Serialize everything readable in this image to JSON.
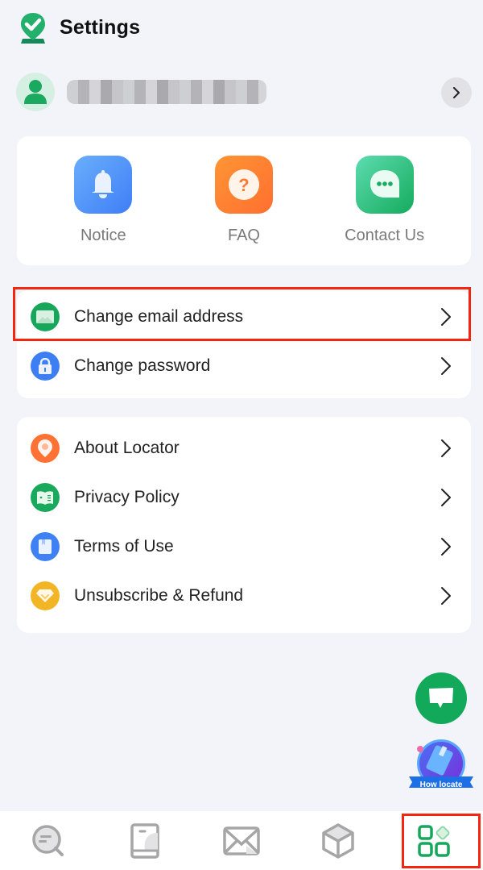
{
  "header": {
    "title": "Settings",
    "logo_icon": "location-check-logo"
  },
  "profile": {
    "avatar_icon": "user-icon",
    "name": "",
    "arrow_icon": "chevron-right-icon"
  },
  "quick_actions": [
    {
      "label": "Notice",
      "icon": "bell-icon",
      "color": "#4a8bf7"
    },
    {
      "label": "FAQ",
      "icon": "question-icon",
      "color": "#ff7a2f"
    },
    {
      "label": "Contact Us",
      "icon": "chat-bubble-icon",
      "color": "#1ab86b"
    }
  ],
  "account_section": [
    {
      "label": "Change email address",
      "icon": "mail-icon",
      "color": "#17a75b",
      "highlighted": true
    },
    {
      "label": "Change password",
      "icon": "lock-icon",
      "color": "#3d7ff2",
      "highlighted": false
    }
  ],
  "about_section": [
    {
      "label": "About Locator",
      "icon": "location-pin-icon",
      "color": "#ff7134"
    },
    {
      "label": "Privacy Policy",
      "icon": "book-icon",
      "color": "#18a95c"
    },
    {
      "label": "Terms of Use",
      "icon": "bookmark-doc-icon",
      "color": "#3f81f4"
    },
    {
      "label": "Unsubscribe & Refund",
      "icon": "diamond-icon",
      "color": "#f2b525"
    }
  ],
  "floating": {
    "chat_icon": "message-icon",
    "how_locate_label": "How locate"
  },
  "tabbar": {
    "tabs": [
      {
        "name": "search-tab",
        "icon": "search-list-icon",
        "active": false
      },
      {
        "name": "guide-tab",
        "icon": "book-tab-icon",
        "active": false
      },
      {
        "name": "messages-tab",
        "icon": "envelope-icon",
        "active": false
      },
      {
        "name": "tools-tab",
        "icon": "cube-icon",
        "active": false
      },
      {
        "name": "settings-tab",
        "icon": "apps-grid-icon",
        "active": true
      }
    ],
    "active_color": "#17a75b",
    "inactive_color": "#a6a6a6"
  },
  "annotation_color": "#f5260f"
}
